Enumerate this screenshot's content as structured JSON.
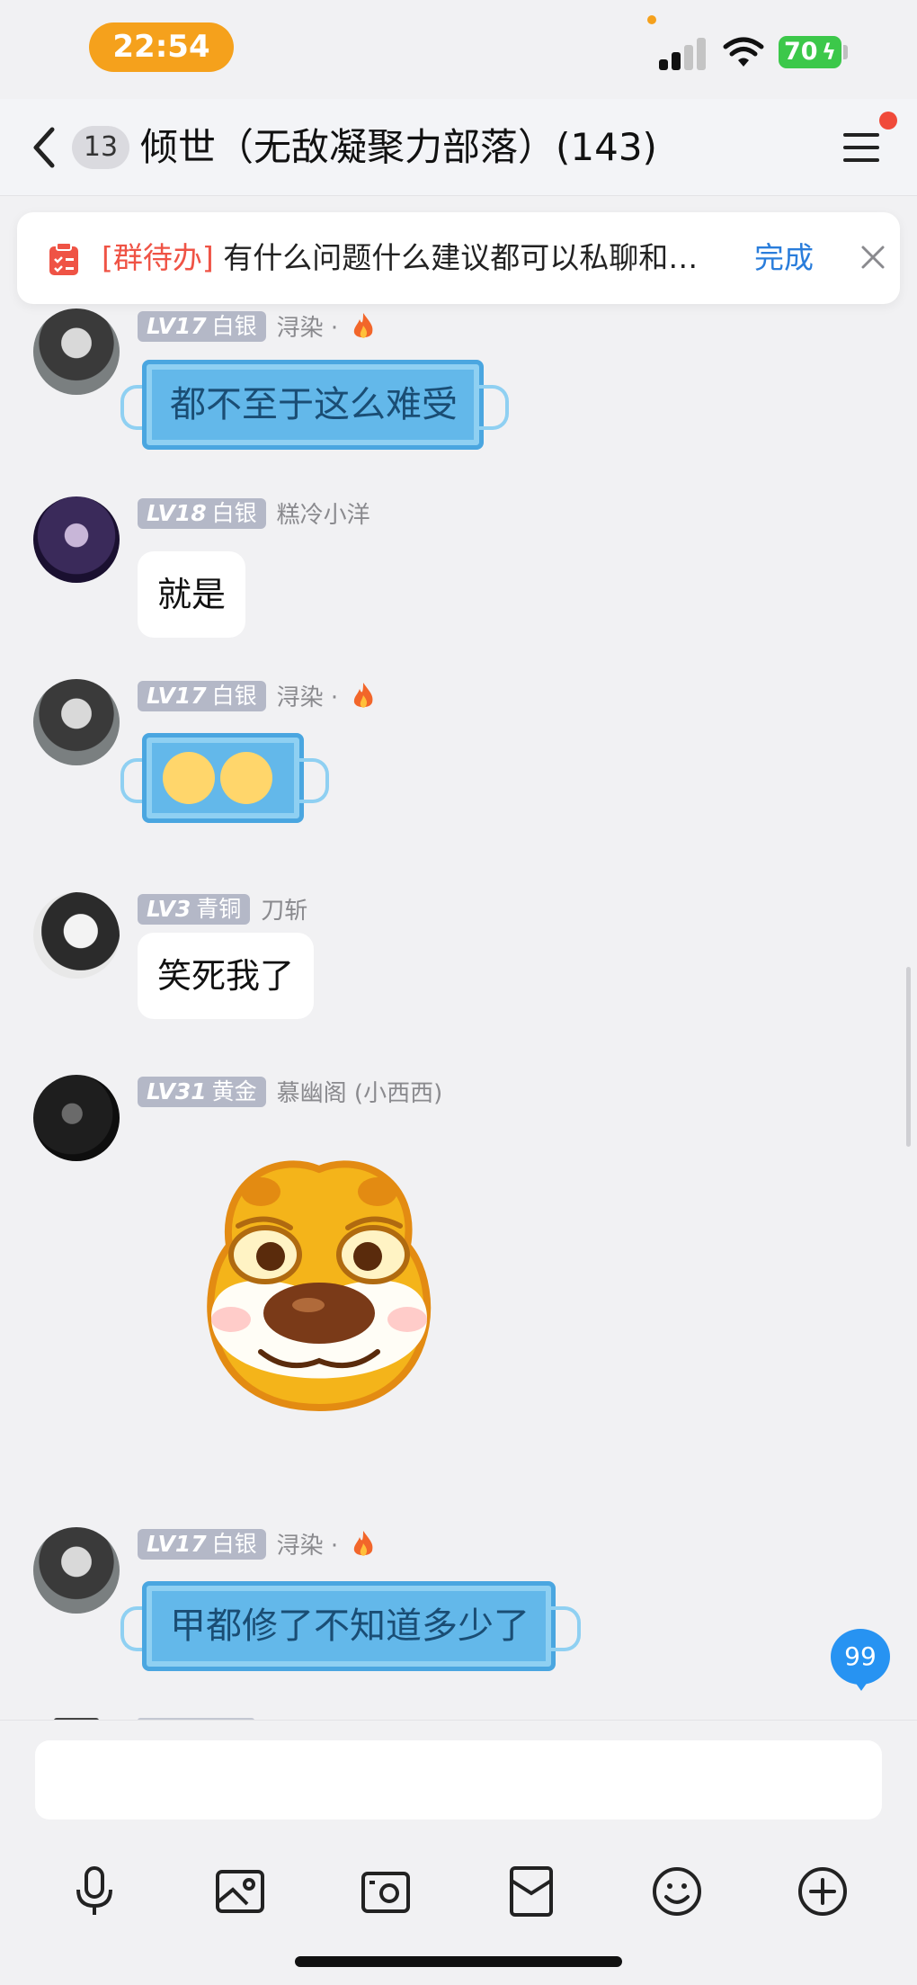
{
  "status_bar": {
    "time": "22:54",
    "battery": "70"
  },
  "nav": {
    "unread_count": "13",
    "title": "倾世（无敌凝聚力部落）(143)"
  },
  "notice": {
    "tag": "[群待办]",
    "text": "有什么问题什么建议都可以私聊和…",
    "done_label": "完成"
  },
  "messages": [
    {
      "level": "LV17",
      "rank": "白银",
      "sender": "浔染 ·",
      "text": "都不至于这么难受",
      "style": "mask"
    },
    {
      "level": "LV18",
      "rank": "白银",
      "sender": "糕冷小洋",
      "text": "就是",
      "style": "white"
    },
    {
      "level": "LV17",
      "rank": "白银",
      "sender": "浔染 ·",
      "text": "",
      "style": "mask-emoji"
    },
    {
      "level": "LV3",
      "rank": "青铜",
      "sender": "刀斩",
      "text": "笑死我了",
      "style": "white"
    },
    {
      "level": "LV31",
      "rank": "黄金",
      "sender": "慕幽阁 (小西西)",
      "text": "",
      "style": "sticker"
    },
    {
      "level": "LV17",
      "rank": "白银",
      "sender": "浔染 ·",
      "text": "甲都修了不知道多少了",
      "style": "mask"
    }
  ],
  "unread_badge": "99",
  "colors": {
    "accent_blue": "#2a7ddb",
    "time_orange": "#f5a11c",
    "battery_green": "#3cc84a",
    "tag_red": "#ef5345"
  },
  "icons": [
    "back-icon",
    "menu-icon",
    "todo-icon",
    "close-icon",
    "fire-icon",
    "microphone-icon",
    "image-icon",
    "camera-icon",
    "red-packet-icon",
    "emoji-icon",
    "plus-icon"
  ]
}
